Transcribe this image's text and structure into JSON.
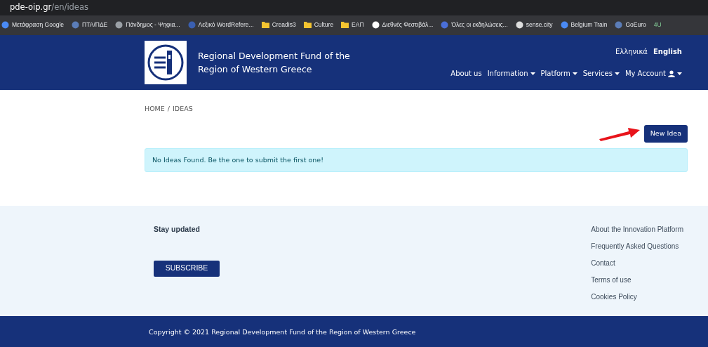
{
  "browser": {
    "url_host": "pde-oip.gr",
    "url_path": "/en/ideas",
    "bookmarks": [
      {
        "label": "Μετάφραση Google",
        "kind": "site"
      },
      {
        "label": "ΠΤΑ/ΠΔΕ",
        "kind": "site"
      },
      {
        "label": "Πάνδημος - Ψηφια...",
        "kind": "site"
      },
      {
        "label": "Λεξικό WordRefere...",
        "kind": "site"
      },
      {
        "label": "Creadis3",
        "kind": "folder"
      },
      {
        "label": "Culture",
        "kind": "folder"
      },
      {
        "label": "ΕΑΠ",
        "kind": "folder"
      },
      {
        "label": "Διεθνές Φεστιβάλ...",
        "kind": "site"
      },
      {
        "label": "Όλες οι εκδηλώσεις...",
        "kind": "site"
      },
      {
        "label": "sense.city",
        "kind": "site"
      },
      {
        "label": "Belgium Train",
        "kind": "site"
      },
      {
        "label": "GoEuro",
        "kind": "site"
      },
      {
        "label": "4U",
        "kind": "cut"
      }
    ]
  },
  "header": {
    "title_line_1": "Regional Development Fund of the",
    "title_line_2": "Region of Western Greece",
    "languages": [
      {
        "label": "Ελληνικά",
        "selected": false
      },
      {
        "label": "English",
        "selected": true
      }
    ],
    "nav": [
      {
        "label": "About us",
        "dropdown": false,
        "icon": false
      },
      {
        "label": "Information",
        "dropdown": true,
        "icon": false
      },
      {
        "label": "Platform",
        "dropdown": true,
        "icon": false
      },
      {
        "label": "Services",
        "dropdown": true,
        "icon": false
      },
      {
        "label": "My Account",
        "dropdown": true,
        "icon": true
      }
    ]
  },
  "breadcrumb": [
    "HOME",
    "IDEAS"
  ],
  "breadcrumb_separator": "/",
  "new_idea_button": "New Idea",
  "alert": "No Ideas Found. Be the one to submit the first one!",
  "footer": {
    "heading": "Stay updated",
    "subscribe_button": "SUBSCRIBE",
    "links": [
      "About the Innovation Platform",
      "Frequently Asked Questions",
      "Contact",
      "Terms of use",
      "Cookies Policy"
    ],
    "copyright": "Copyright © 2021 Regional Development Fund of the Region of Western Greece"
  }
}
